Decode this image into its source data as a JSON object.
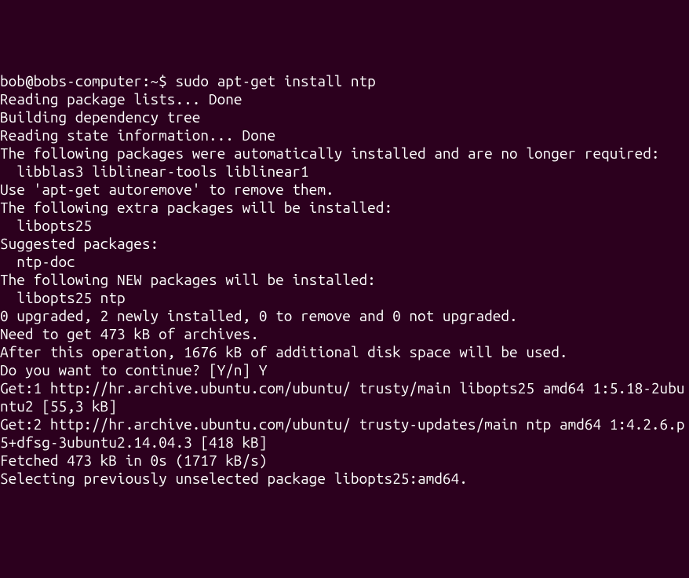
{
  "terminal": {
    "prompt": "bob@bobs-computer:~$ ",
    "command": "sudo apt-get install ntp",
    "lines": [
      "Reading package lists... Done",
      "Building dependency tree",
      "Reading state information... Done",
      "The following packages were automatically installed and are no longer required:",
      "  libblas3 liblinear-tools liblinear1",
      "Use 'apt-get autoremove' to remove them.",
      "The following extra packages will be installed:",
      "  libopts25",
      "Suggested packages:",
      "  ntp-doc",
      "The following NEW packages will be installed:",
      "  libopts25 ntp",
      "0 upgraded, 2 newly installed, 0 to remove and 0 not upgraded.",
      "Need to get 473 kB of archives.",
      "After this operation, 1676 kB of additional disk space will be used.",
      "Do you want to continue? [Y/n] Y",
      "Get:1 http://hr.archive.ubuntu.com/ubuntu/ trusty/main libopts25 amd64 1:5.18-2ubuntu2 [55,3 kB]",
      "Get:2 http://hr.archive.ubuntu.com/ubuntu/ trusty-updates/main ntp amd64 1:4.2.6.p5+dfsg-3ubuntu2.14.04.3 [418 kB]",
      "Fetched 473 kB in 0s (1717 kB/s)",
      "Selecting previously unselected package libopts25:amd64."
    ]
  }
}
